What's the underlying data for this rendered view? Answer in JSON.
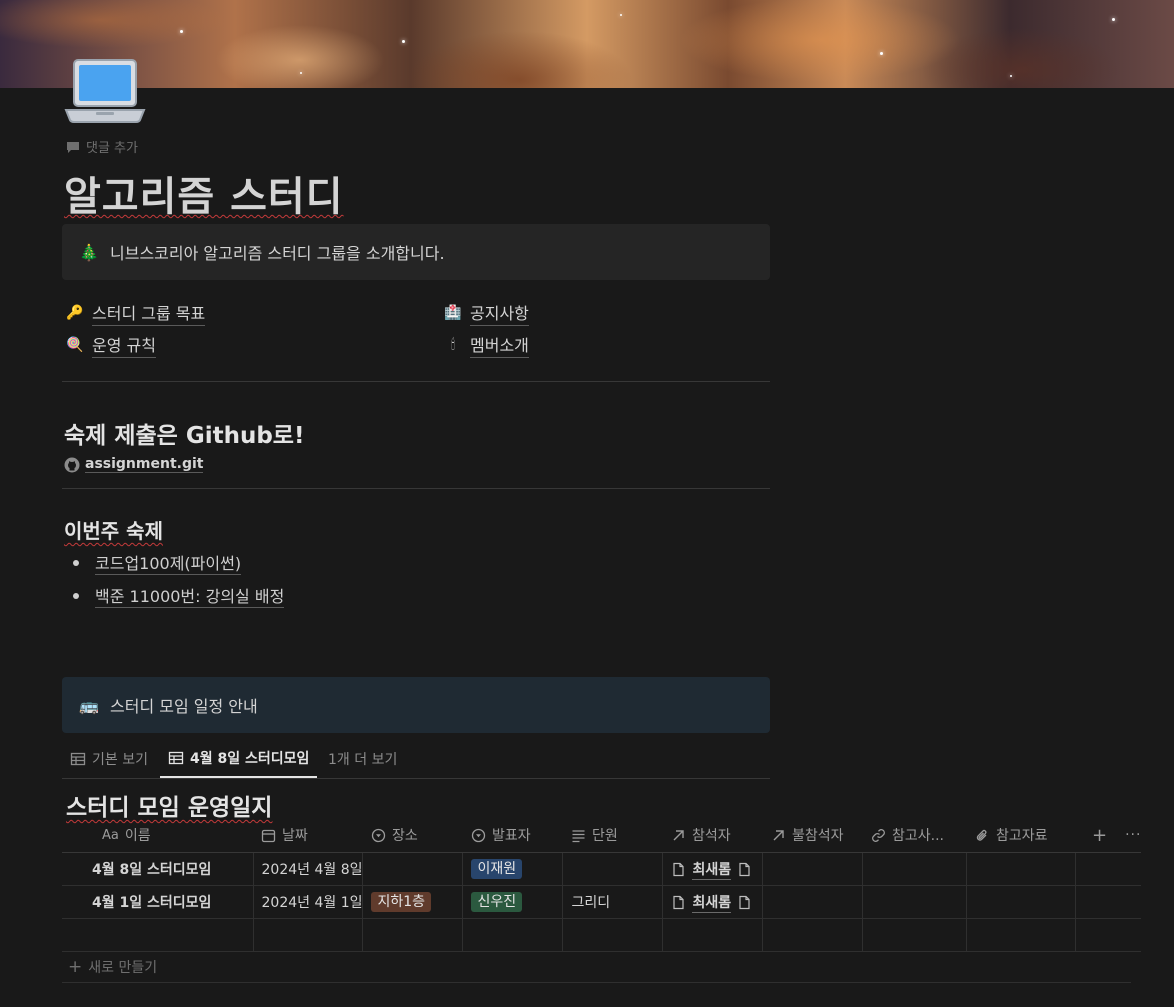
{
  "page": {
    "title": "알고리즘 스터디",
    "comment_label": "댓글 추가",
    "icon": "laptop-icon",
    "cover": "nebula-cover"
  },
  "callout_intro": {
    "icon": "christmas-tree-icon",
    "text": "니브스코리아 알고리즘 스터디 그룹을 소개합니다."
  },
  "links": [
    {
      "icon": "key-icon",
      "label": "스터디 그룹 목표"
    },
    {
      "icon": "hospital-icon",
      "label": "공지사항"
    },
    {
      "icon": "lollipop-icon",
      "label": "운영 규칙"
    },
    {
      "icon": "candle-icon",
      "label": "멤버소개"
    }
  ],
  "homework_section": {
    "heading": "숙제 제출은 Github로!",
    "git_link": "assignment.git"
  },
  "weekly": {
    "heading": "이번주 숙제",
    "items": [
      "코드업100제(파이썬)",
      "백준 11000번: 강의실 배정"
    ]
  },
  "callout_schedule": {
    "icon": "bus-icon",
    "text": "스터디 모임 일정 안내"
  },
  "tabs": [
    "기본 보기",
    "4월 8일 스터디모임",
    "1개 더 보기"
  ],
  "database": {
    "title": "스터디 모임 운영일지",
    "columns": [
      "이름",
      "날짜",
      "장소",
      "발표자",
      "단원",
      "참석자",
      "불참석자",
      "참고사...",
      "참고자료"
    ],
    "column_icons": {
      "name": "Aa",
      "date": "calendar-icon",
      "place": "select-icon",
      "presenter": "select-icon",
      "unit": "text-lines-icon",
      "attendees": "relation-arrow-icon",
      "absentees": "relation-arrow-icon",
      "ref_url": "link-icon",
      "ref_files": "paperclip-icon"
    },
    "rows": [
      {
        "name": "4월 8일 스터디모임",
        "date": "2024년 4월 8일",
        "place": "",
        "presenter": "이재원",
        "unit": "",
        "attendee": "최새롬"
      },
      {
        "name": "4월 1일 스터디모임",
        "date": "2024년 4월 1일",
        "place": "지하1층",
        "presenter": "신우진",
        "unit": "그리디",
        "attendee": "최새롬"
      }
    ],
    "add_column": "+",
    "more": "···",
    "new_row_label": "새로 만들기",
    "tag_colors": {
      "blue": "#28456c",
      "green": "#2b593f",
      "brown": "#603b2c"
    }
  }
}
